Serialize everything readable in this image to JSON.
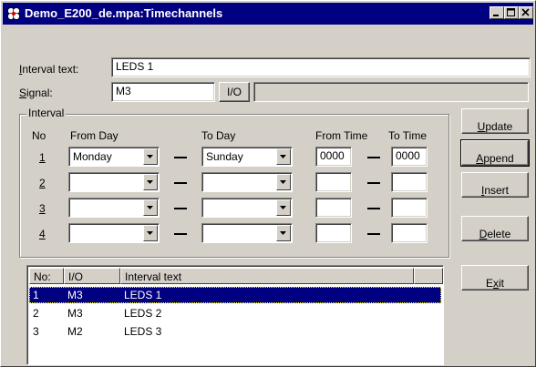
{
  "window": {
    "title": "Demo_E200_de.mpa:Timechannels",
    "icon": "app-clover-icon"
  },
  "form": {
    "interval_text_label": "Interval text:",
    "interval_text_value": "LEDS 1",
    "signal_label": "Signal:",
    "signal_value": "M3",
    "io_button": "I/O",
    "signal_desc": ""
  },
  "interval": {
    "legend": "Interval",
    "headers": {
      "no": "No",
      "from_day": "From Day",
      "to_day": "To Day",
      "from_time": "From Time",
      "to_time": "To Time"
    },
    "rows": [
      {
        "no": "1",
        "from_day": "Monday",
        "to_day": "Sunday",
        "from_time": "0000",
        "to_time": "0000"
      },
      {
        "no": "2",
        "from_day": "",
        "to_day": "",
        "from_time": "",
        "to_time": ""
      },
      {
        "no": "3",
        "from_day": "",
        "to_day": "",
        "from_time": "",
        "to_time": ""
      },
      {
        "no": "4",
        "from_day": "",
        "to_day": "",
        "from_time": "",
        "to_time": ""
      }
    ]
  },
  "buttons": {
    "update": "Update",
    "append": "Append",
    "insert": "Insert",
    "delete": "Delete",
    "exit": "Exit"
  },
  "list": {
    "columns": [
      "No:",
      "I/O",
      "Interval text",
      ""
    ],
    "rows": [
      {
        "no": "1",
        "io": "M3",
        "text": "LEDS 1",
        "selected": true
      },
      {
        "no": "2",
        "io": "M3",
        "text": "LEDS 2",
        "selected": false
      },
      {
        "no": "3",
        "io": "M2",
        "text": "LEDS 3",
        "selected": false
      }
    ]
  },
  "colors": {
    "titlebar": "#000080",
    "selection": "#000080",
    "face": "#d4d0c8"
  }
}
